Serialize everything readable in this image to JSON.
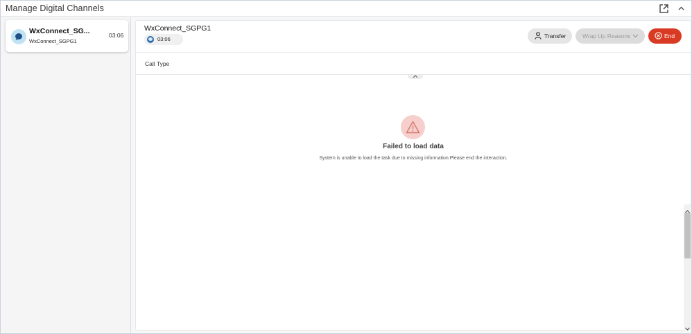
{
  "window": {
    "title": "Manage Digital Channels"
  },
  "sidebar": {
    "task": {
      "name": "WxConnect_SG...",
      "subtitle": "WxConnect_SGPG1",
      "timer": "03:06"
    }
  },
  "main": {
    "header": {
      "title": "WxConnect_SGPG1",
      "timer": "03:06"
    },
    "buttons": {
      "transfer": "Transfer",
      "wrap_up": "Wrap Up Reasons",
      "end": "End"
    },
    "call_type_label": "Call Type",
    "error": {
      "title": "Failed to load data",
      "message": "System is unable to load the task due to missing information.Please end the interaction."
    }
  },
  "colors": {
    "accent_blue": "#2b6fb0",
    "end_red": "#d93a23",
    "warning_bg": "#f6cfcc",
    "warning_stroke": "#d8766b"
  }
}
